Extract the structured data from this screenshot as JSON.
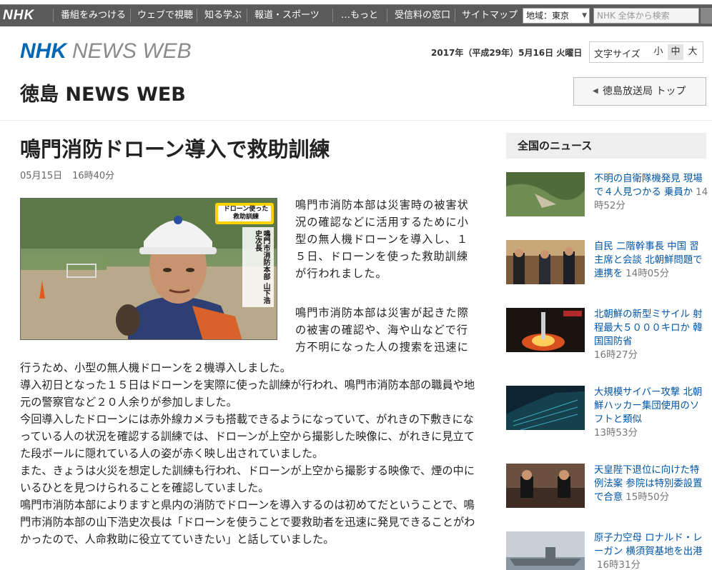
{
  "nav": {
    "logo": "NHK",
    "items": [
      "番組をみつける",
      "ウェブで視聴",
      "知る学ぶ",
      "報道・スポーツ",
      "…もっと",
      "受信料の窓口",
      "サイトマップ"
    ],
    "region_label": "地域：東京",
    "search_placeholder": "NHK 全体から検索"
  },
  "header": {
    "logo_nhk": "NHK",
    "logo_news": "NEWS WEB",
    "date": "2017年（平成29年）5月16日 火曜日",
    "font_size_label": "文字サイズ",
    "font_sizes": [
      "小",
      "中",
      "大"
    ],
    "font_size_selected": "中",
    "region_title": "徳島 NEWS WEB",
    "station_button": "徳島放送局 トップ"
  },
  "article": {
    "title": "鳴門消防ドローン導入で救助訓練",
    "date": "05月15日",
    "time": "16時40分",
    "photo_caption_badge": "ドローン使った救助訓練",
    "photo_caption_name": "鳴門市消防本部 山下浩史次長",
    "p1": "鳴門市消防本部は災害時の被害状況の確認などに活用するために小型の無人機ドローンを導入し、１５日、ドローンを使った救助訓練が行われました。",
    "p2": "鳴門市消防本部は災害が起きた際の被害の確認や、海や山などで行方不明になった人の捜索を迅速に",
    "p3": "行うため、小型の無人機ドローンを２機導入しました。\n導入初日となった１５日はドローンを実際に使った訓練が行われ、鳴門市消防本部の職員や地元の警察官など２０人余りが参加しました。\n今回導入したドローンには赤外線カメラも搭載できるようになっていて、がれきの下敷きになっている人の状況を確認する訓練では、ドローンが上空から撮影した映像に、がれきに見立てた段ボールに隠れている人の姿が赤く映し出されていました。\nまた、きょうは火災を想定した訓練も行われ、ドローンが上空から撮影する映像で、煙の中にいるひとを見つけられることを確認していました。\n鳴門市消防本部によりますと県内の消防でドローンを導入するのは初めてだということで、鳴門市消防本部の山下浩史次長は「ドローンを使うことで要救助者を迅速に発見できることがわかったので、人命救助に役立てていきたい」と話していました。"
  },
  "sidebar": {
    "heading": "全国のニュース",
    "items": [
      {
        "title": "不明の自衛隊機発見 現場で４人見つかる 乗員か",
        "time": "14時52分"
      },
      {
        "title": "自民 二階幹事長 中国 習主席と会談 北朝鮮問題で連携を",
        "time": "14時05分"
      },
      {
        "title": "北朝鮮の新型ミサイル 射程最大５０００キロか 韓国国防省",
        "time": "16時27分"
      },
      {
        "title": "大規模サイバー攻撃 北朝鮮ハッカー集団使用のソフトと類似",
        "time": "13時53分"
      },
      {
        "title": "天皇陛下退位に向けた特例法案 参院は特別委設置で合意",
        "time": "15時50分"
      },
      {
        "title": "原子力空母 ロナルド・レーガン 横須賀基地を出港",
        "time": "16時31分"
      }
    ]
  },
  "colors": {
    "nhk_blue": "#0067b4",
    "nav_bg": "#5a5a5a",
    "link_blue": "#0055a5"
  }
}
